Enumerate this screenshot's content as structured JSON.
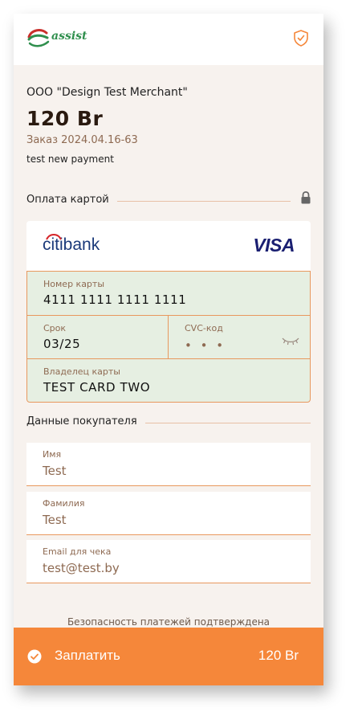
{
  "header": {
    "logo_text": "assist",
    "shield_icon": "shield-check-icon"
  },
  "payment": {
    "merchant": "OOO \"Design Test Merchant\"",
    "amount": "120 Br",
    "order": "Заказ 2024.04.16-63",
    "description": "test new payment"
  },
  "card_section": {
    "label": "Оплата картой",
    "bank": "citibank",
    "brand": "VISA",
    "number_label": "Номер карты",
    "number_value": "4111 1111 1111 1111",
    "expiry_label": "Срок",
    "expiry_value": "03/25",
    "cvc_label": "CVC-код",
    "cvc_value": "• • •",
    "holder_label": "Владелец карты",
    "holder_value": "TEST CARD TWO"
  },
  "buyer_section": {
    "label": "Данные покупателя",
    "fields": [
      {
        "label": "Имя",
        "value": "Test"
      },
      {
        "label": "Фамилия",
        "value": "Test"
      },
      {
        "label": "Email для чека",
        "value": "test@test.by"
      }
    ]
  },
  "footer": {
    "security_note": "Безопасность платежей подтверждена",
    "pay_label": "Заплатить",
    "pay_amount": "120 Br"
  },
  "colors": {
    "accent": "#f5873a",
    "background": "#f7f2ee",
    "card_fields_bg": "#e6efe2",
    "muted_text": "#8e6a52"
  }
}
